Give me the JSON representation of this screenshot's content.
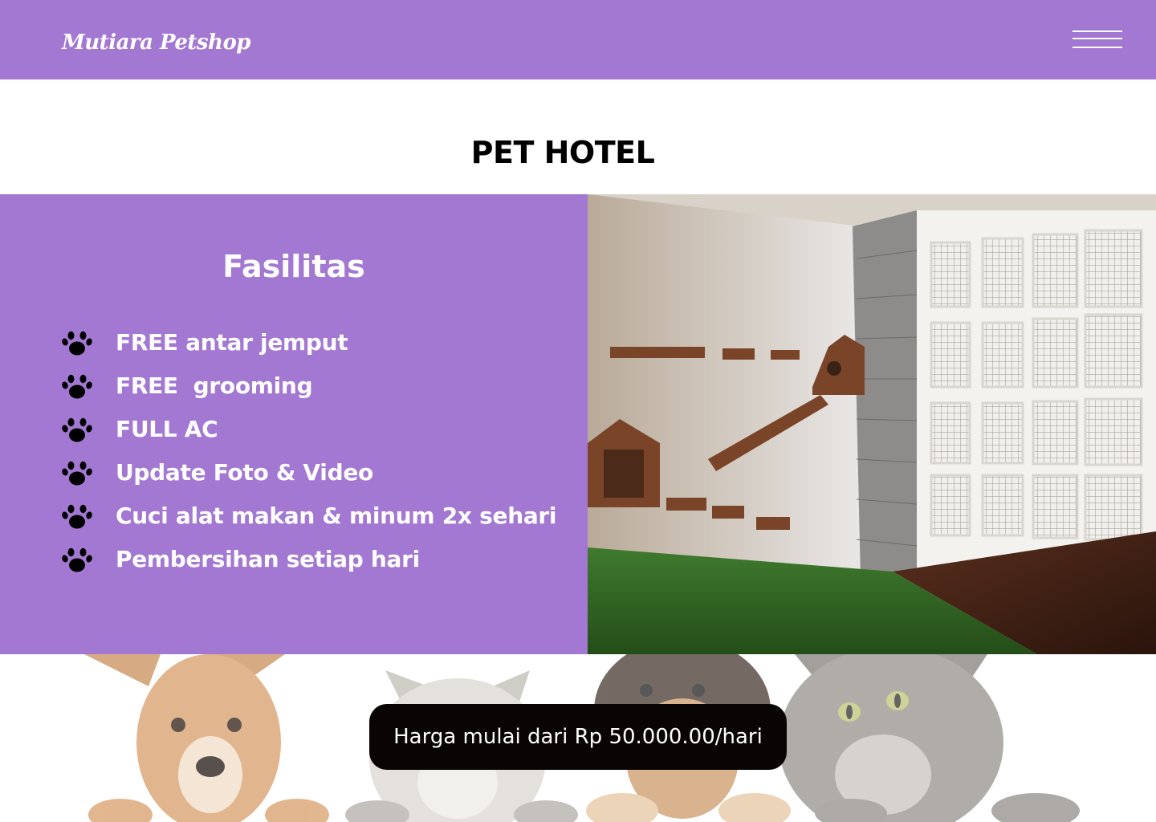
{
  "header": {
    "brand": "Mutiara Petshop",
    "menu_icon": "hamburger-menu-icon",
    "background": "#a378d2"
  },
  "page_title": "PET HOTEL",
  "facilities": {
    "heading": "Fasilitas",
    "bullet_icon": "paw-print-icon",
    "items": [
      {
        "label": "FREE antar jemput"
      },
      {
        "label": "FREE  grooming"
      },
      {
        "label": "FULL AC"
      },
      {
        "label": "Update Foto & Video"
      },
      {
        "label": "Cuci alat makan & minum 2x sehari"
      },
      {
        "label": "Pembersihan setiap hari"
      }
    ]
  },
  "price_button": {
    "label": "Harga mulai dari Rp 50.000.00/hari"
  },
  "colors": {
    "accent": "#a378d2",
    "text_on_accent": "#ffffff",
    "button_bg": "#0a0505"
  }
}
